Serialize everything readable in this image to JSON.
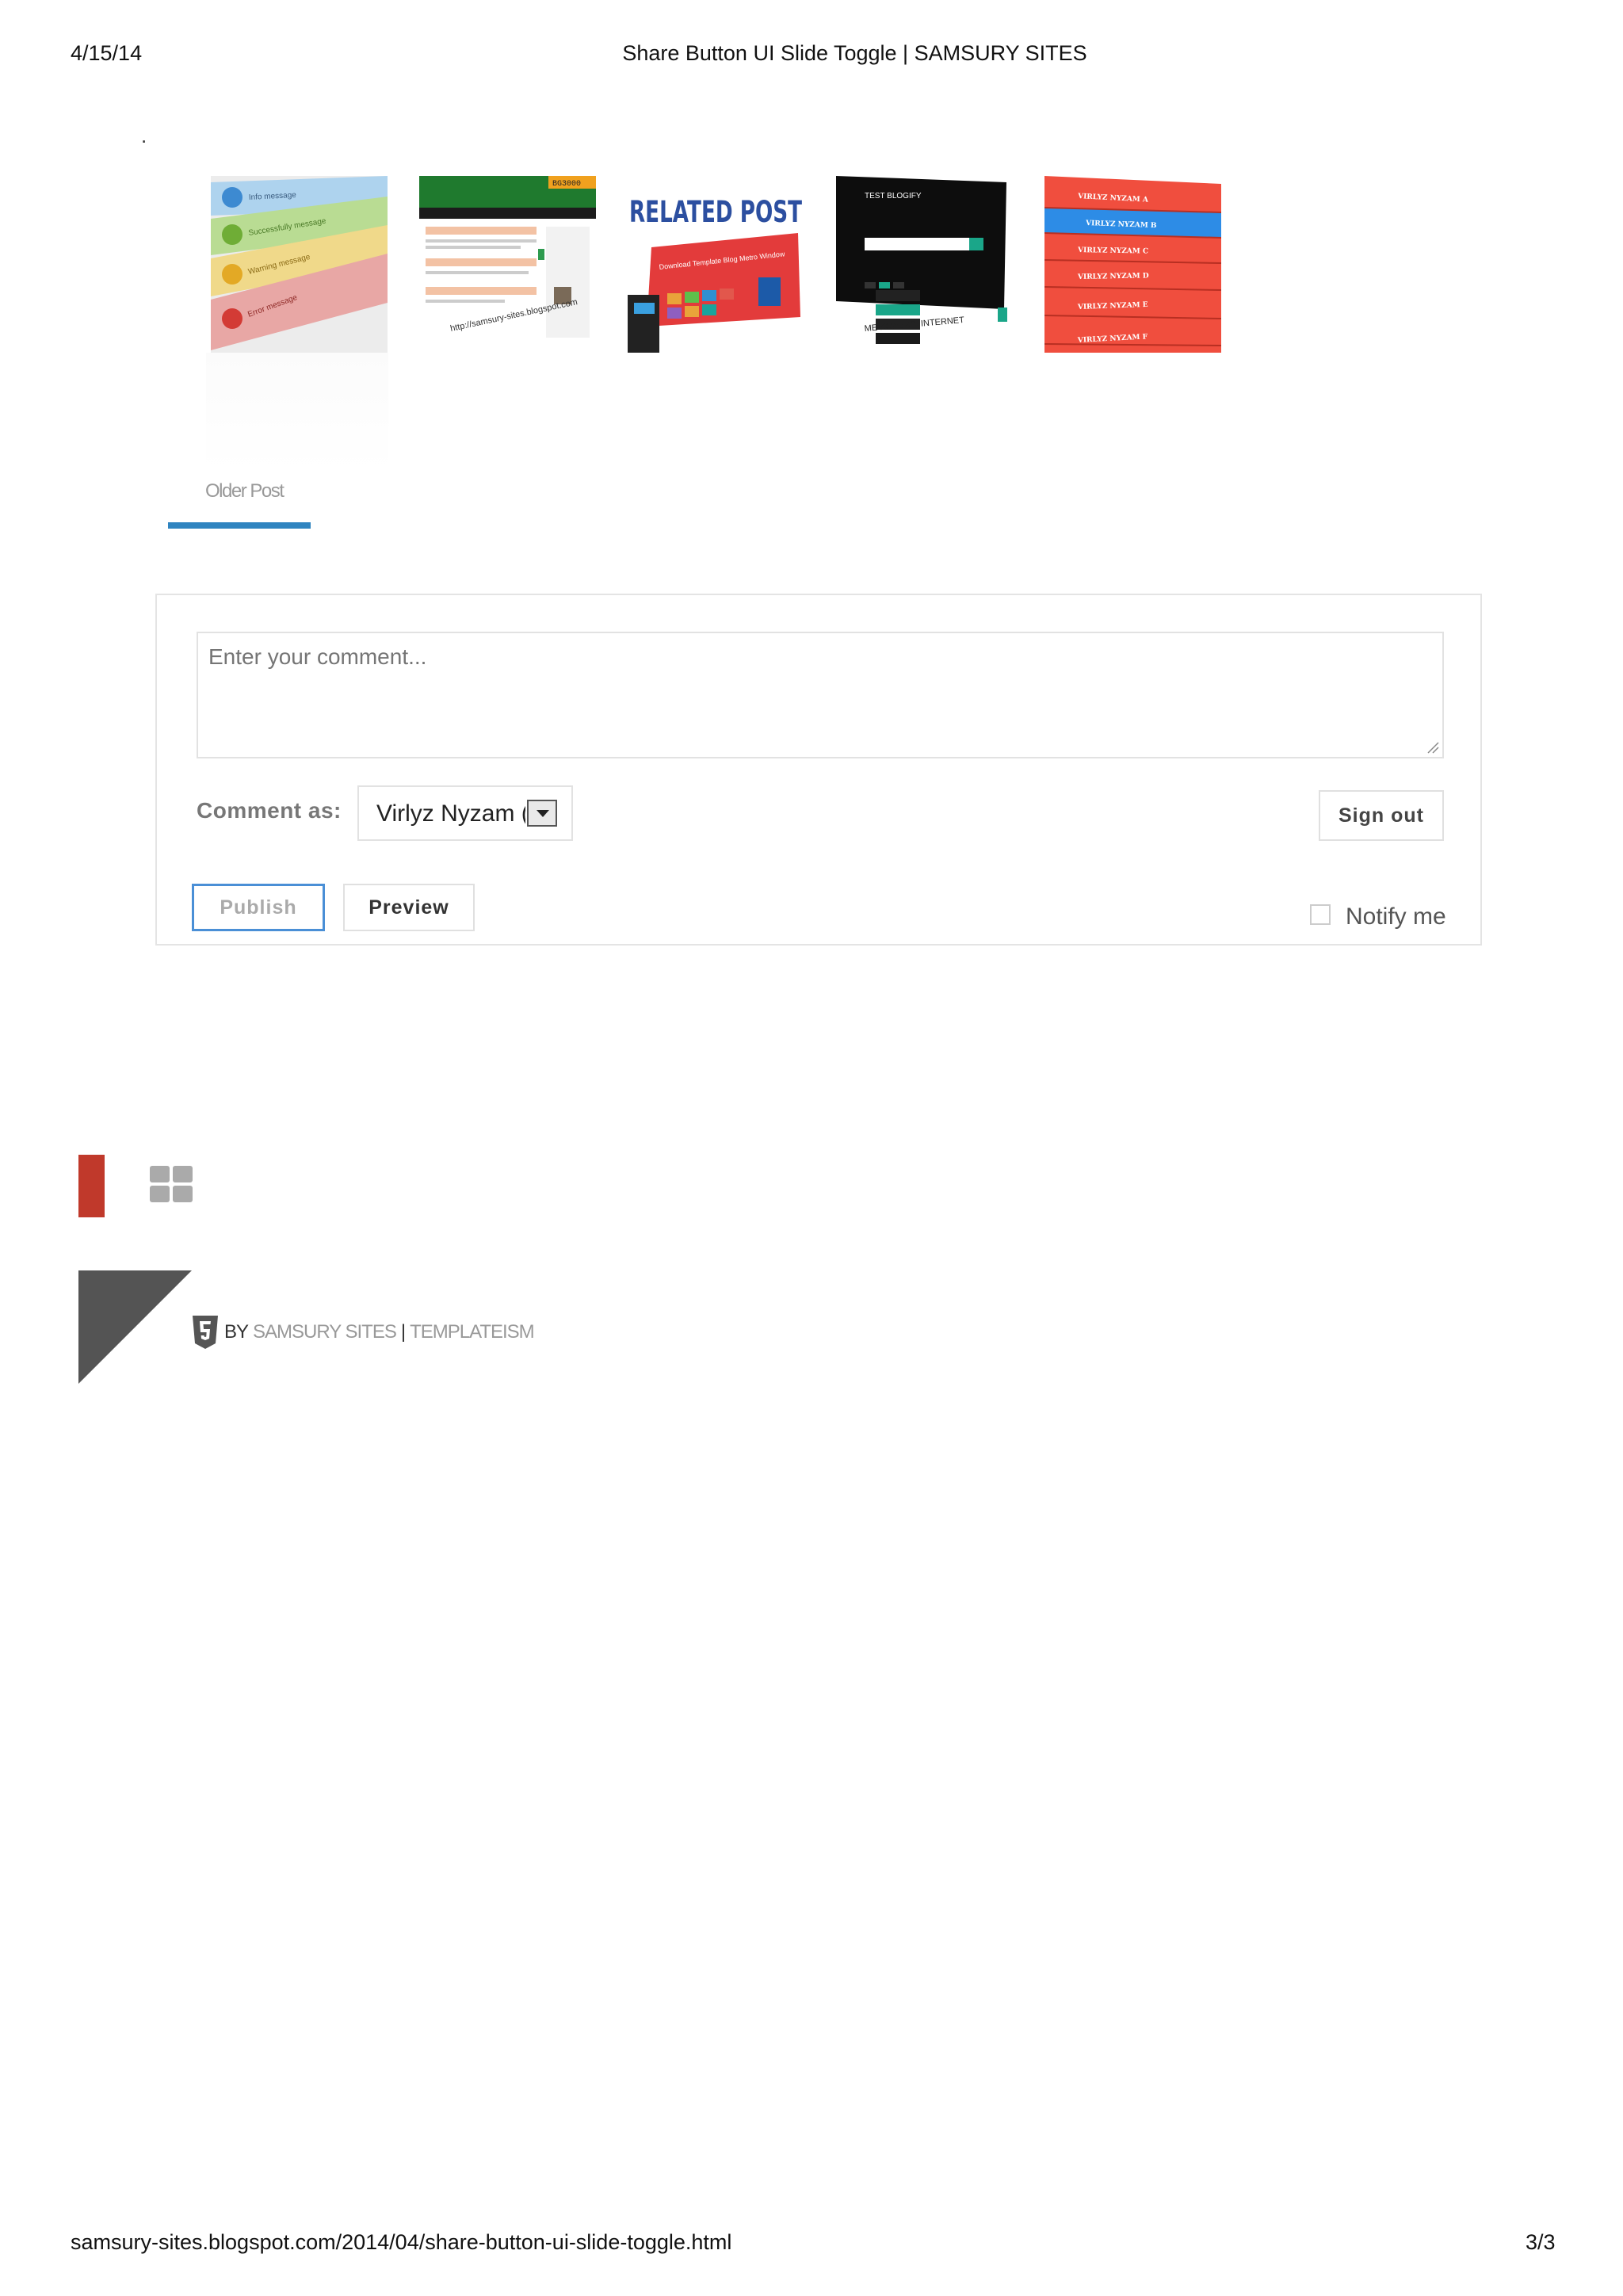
{
  "pdf_header": {
    "date": "4/15/14",
    "title": "Share Button UI Slide Toggle | SAMSURY SITES"
  },
  "pdf_footer": {
    "url": "samsury-sites.blogspot.com/2014/04/share-button-ui-slide-toggle.html",
    "page": "3/3"
  },
  "dot": ".",
  "related_posts": {
    "thumb1": {
      "lines": [
        "Info message",
        "Successfully message",
        "Warning message",
        "Error message"
      ]
    },
    "thumb2": {
      "badge": "BG3000",
      "url": "http://samsury-sites.blogspot.com"
    },
    "thumb3": {
      "title": "RELATED POST",
      "banner": "Download Template Blog Metro Window"
    },
    "thumb4": {
      "header": "TEST BLOGIFY",
      "caption": "ME  KONEKSI INTERNET"
    },
    "thumb5": {
      "items": [
        "VIRLYZ NYZAM A",
        "VIRLYZ NYZAM B",
        "VIRLYZ NYZAM C",
        "VIRLYZ NYZAM D",
        "VIRLYZ NYZAM E",
        "VIRLYZ NYZAM F"
      ]
    }
  },
  "nav": {
    "older_post": "Older Post"
  },
  "comment_form": {
    "placeholder": "Enter your comment...",
    "comment_as_label": "Comment as:",
    "identity_value": "Virlyz Nyzam (",
    "sign_out": "Sign out",
    "publish": "Publish",
    "preview": "Preview",
    "notify_label": "Notify me"
  },
  "footer_credit": {
    "by": "BY",
    "site": "SAMSURY SITES",
    "separator": "|",
    "theme": "TEMPLATEISM"
  },
  "colors": {
    "accent_blue": "#2f84c0",
    "widget_red": "#c0392b",
    "corner_gray": "#545454",
    "link_gray": "#999999"
  }
}
